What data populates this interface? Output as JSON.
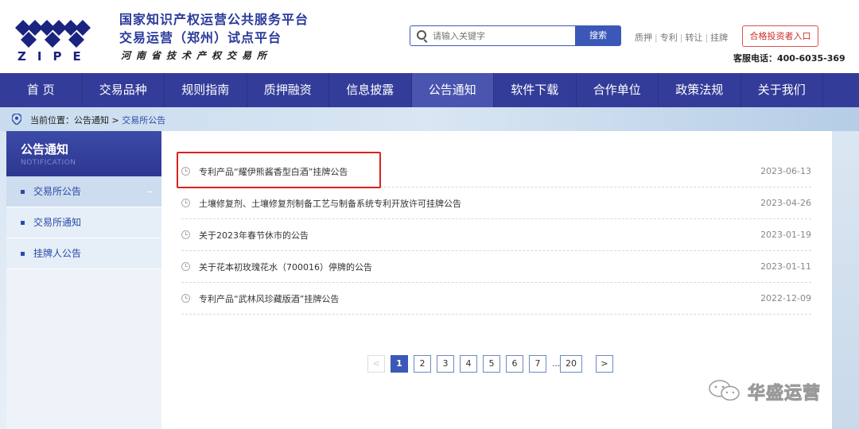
{
  "header": {
    "logo_text": "ZIPE",
    "title_line1": "国家知识产权运营公共服务平台",
    "title_line2": "交易运营（郑州）试点平台",
    "title_line3": "河南省技术产权交易所",
    "search_placeholder": "请输入关键字",
    "search_button": "搜索",
    "quick_links": [
      "质押",
      "专利",
      "转让",
      "挂牌"
    ],
    "investor_button": "合格投资者入口",
    "hotline": "客服电话：400-6035-369"
  },
  "nav": {
    "items": [
      "首 页",
      "交易品种",
      "规则指南",
      "质押融资",
      "信息披露",
      "公告通知",
      "软件下载",
      "合作单位",
      "政策法规",
      "关于我们"
    ],
    "active_index": 5
  },
  "breadcrumb": {
    "label": "当前位置：",
    "parent": "公告通知",
    "separator": " > ",
    "current": "交易所公告"
  },
  "sidebar": {
    "title": "公告通知",
    "subtitle": "NOTIFICATION",
    "items": [
      "交易所公告",
      "交易所通知",
      "挂牌人公告"
    ],
    "active_index": 0
  },
  "notices": [
    {
      "title": "专利产品“耀伊熊酱香型白酒”挂牌公告",
      "date": "2023-06-13"
    },
    {
      "title": "土壤修复剂、土壤修复剂制备工艺与制备系统专利开放许可挂牌公告",
      "date": "2023-04-26"
    },
    {
      "title": "关于2023年春节休市的公告",
      "date": "2023-01-19"
    },
    {
      "title": "关于花本初玫瑰花水（700016）停牌的公告",
      "date": "2023-01-11"
    },
    {
      "title": "专利产品“武林风珍藏版酒”挂牌公告",
      "date": "2022-12-09"
    }
  ],
  "pagination": {
    "prev": "<",
    "pages": [
      "1",
      "2",
      "3",
      "4",
      "5",
      "6",
      "7"
    ],
    "ellipsis": "...",
    "last": "20",
    "next": ">",
    "current": "1"
  },
  "watermark": {
    "text": "华盛运营"
  },
  "colors": {
    "nav_bg": "#333d99",
    "nav_active": "#4a55b0",
    "brand_blue": "#3b58b8",
    "highlight_red": "#d9231d"
  }
}
